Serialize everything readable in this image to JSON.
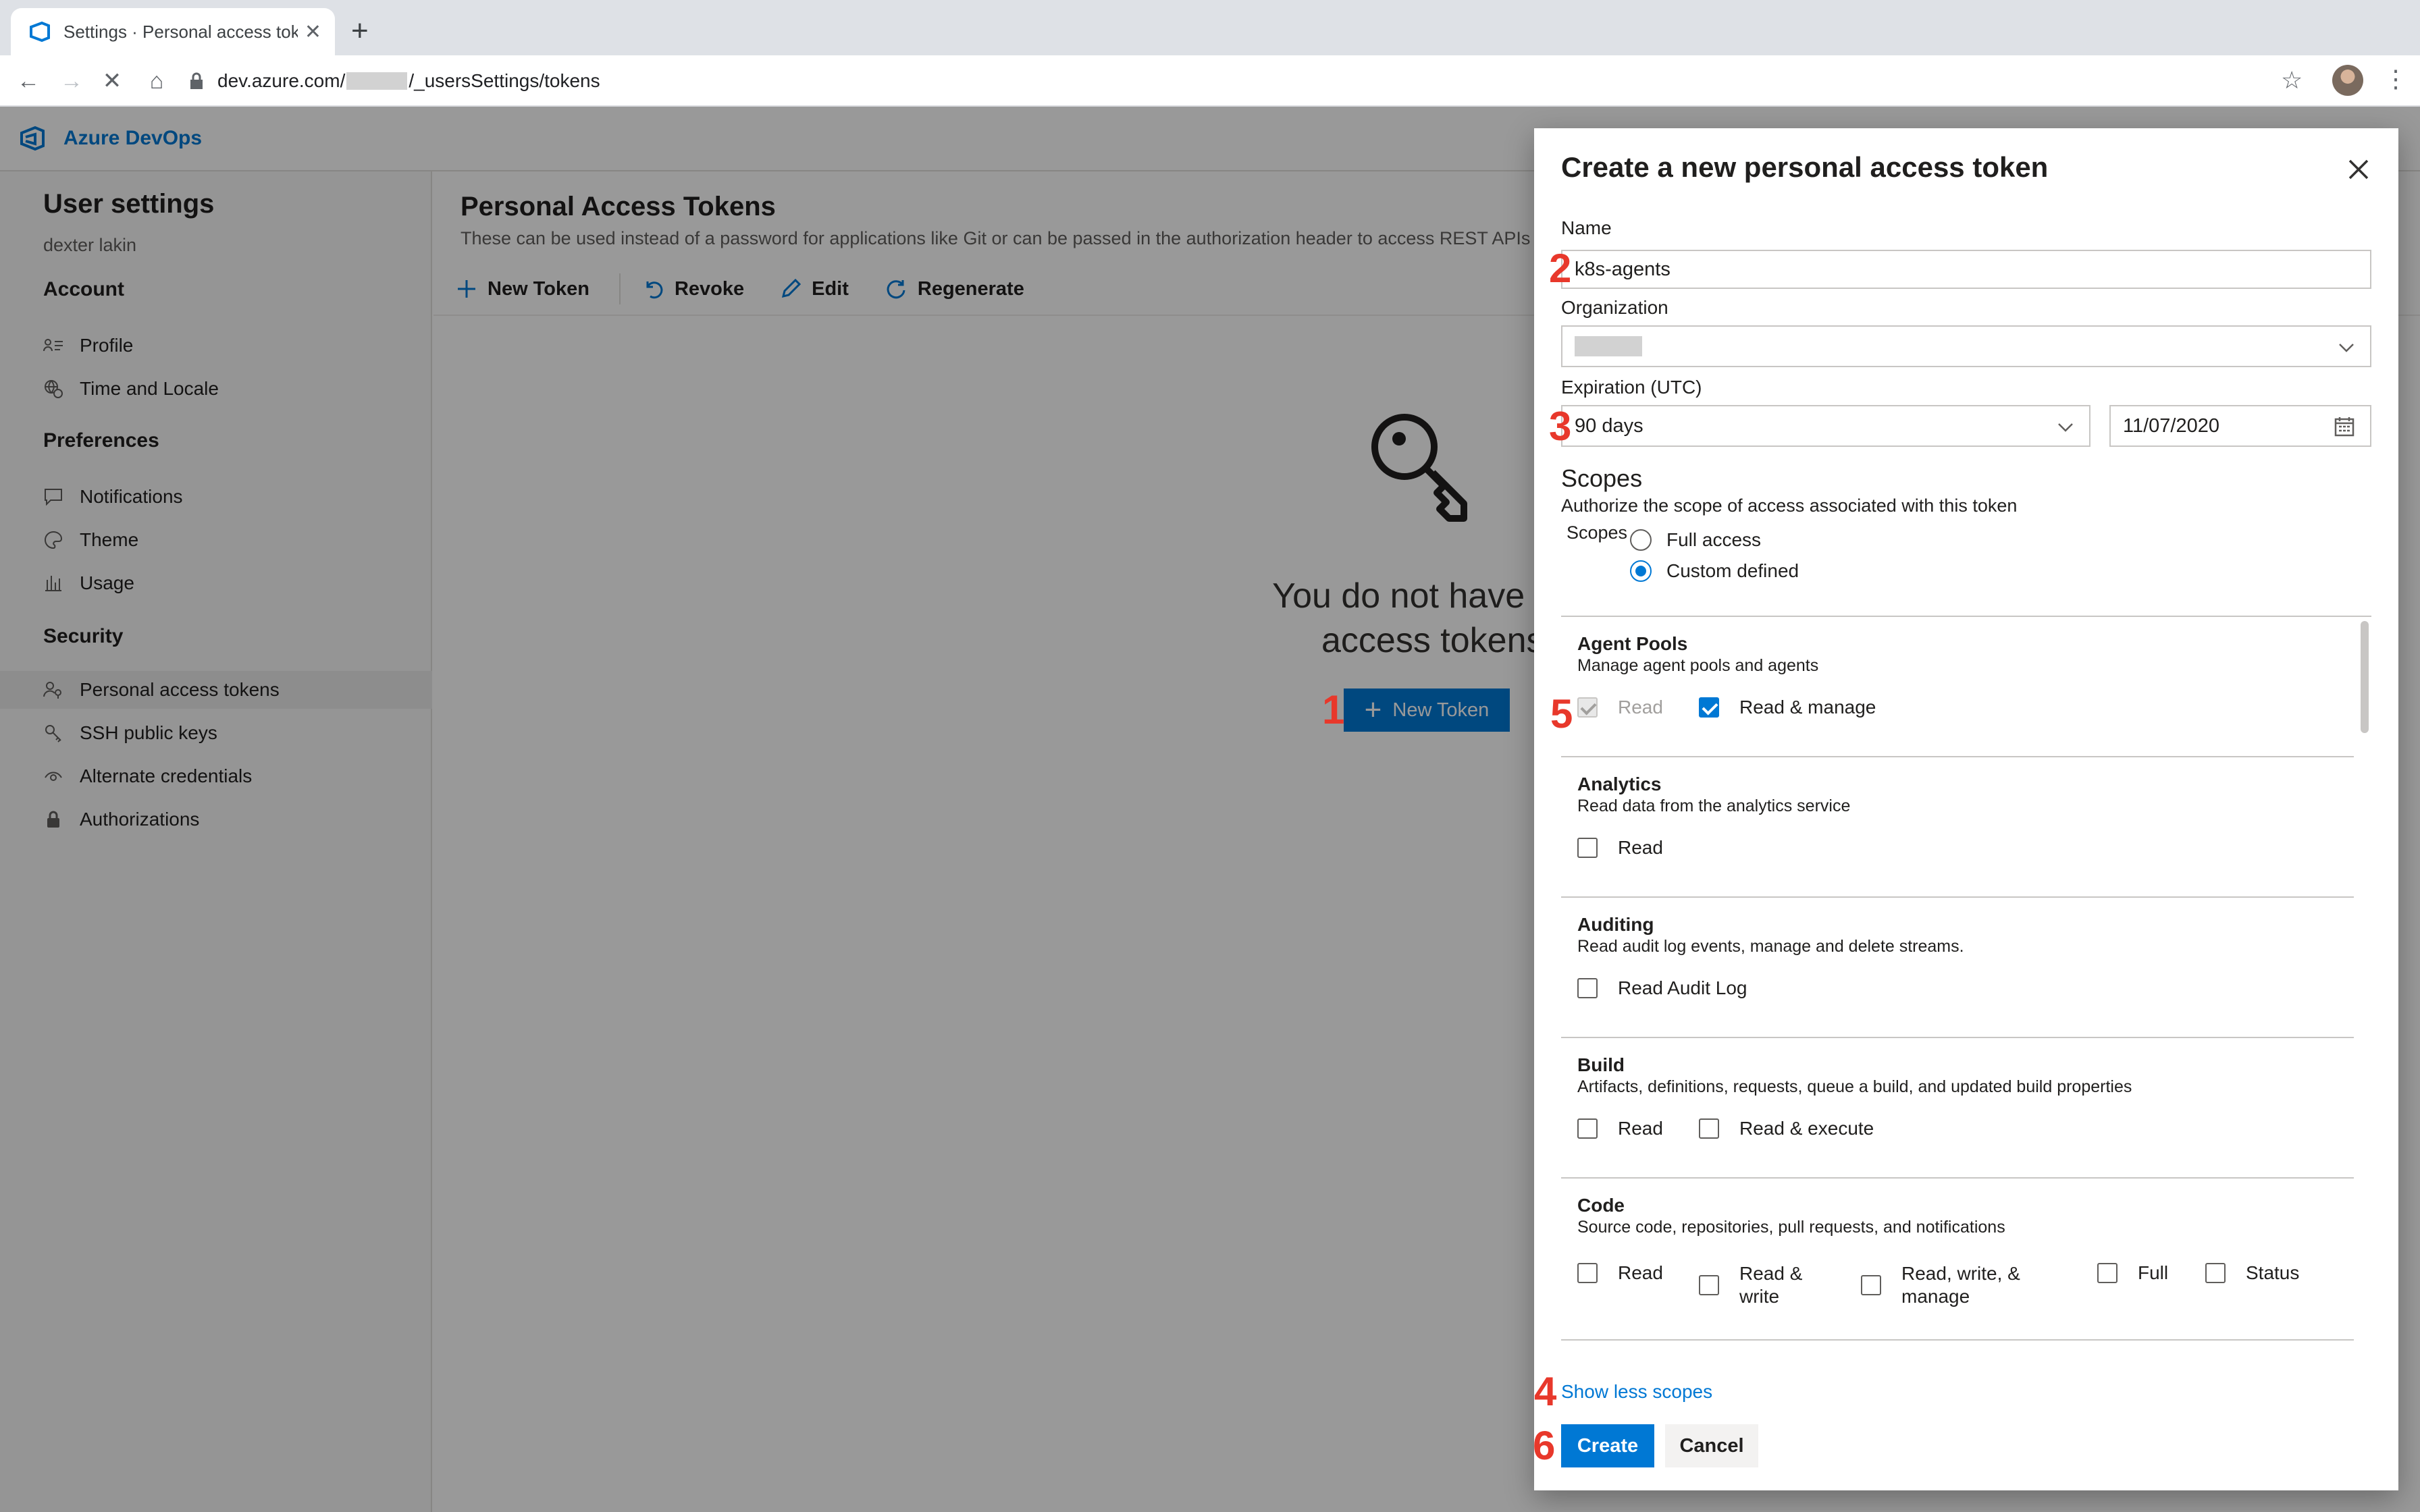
{
  "browser": {
    "tab_title": "Settings · Personal access tokens",
    "url_host": "dev.azure.com/",
    "url_path": "/_usersSettings/tokens"
  },
  "app": {
    "brand": "Azure DevOps",
    "colors": {
      "accent": "#0078d4",
      "annotation": "#e8382b"
    }
  },
  "sidebar": {
    "title": "User settings",
    "user": "dexter lakin",
    "sections": [
      {
        "title": "Account",
        "items": [
          {
            "label": "Profile",
            "icon": "profile-icon"
          },
          {
            "label": "Time and Locale",
            "icon": "globe-clock-icon"
          }
        ]
      },
      {
        "title": "Preferences",
        "items": [
          {
            "label": "Notifications",
            "icon": "chat-icon"
          },
          {
            "label": "Theme",
            "icon": "palette-icon"
          },
          {
            "label": "Usage",
            "icon": "chart-icon"
          }
        ]
      },
      {
        "title": "Security",
        "items": [
          {
            "label": "Personal access tokens",
            "icon": "people-key-icon",
            "active": true
          },
          {
            "label": "SSH public keys",
            "icon": "key-icon"
          },
          {
            "label": "Alternate credentials",
            "icon": "eye-icon"
          },
          {
            "label": "Authorizations",
            "icon": "lock-icon"
          }
        ]
      }
    ]
  },
  "main": {
    "title": "Personal Access Tokens",
    "description": "These can be used instead of a password for applications like Git or can be passed in the authorization header to access REST APIs",
    "toolbar": {
      "new_token": "New Token",
      "revoke": "Revoke",
      "edit": "Edit",
      "regenerate": "Regenerate"
    },
    "empty_line1": "You do not have any p",
    "empty_line2": "access tokens y",
    "new_token_button": "New Token"
  },
  "dialog": {
    "title": "Create a new personal access token",
    "name_label": "Name",
    "name_value": "k8s-agents",
    "organization_label": "Organization",
    "organization_value": "",
    "expiration_label": "Expiration (UTC)",
    "expiration_value": "90 days",
    "expiration_date": "11/07/2020",
    "scopes_heading": "Scopes",
    "scopes_description": "Authorize the scope of access associated with this token",
    "scopes_label": "Scopes",
    "scope_mode_full": "Full access",
    "scope_mode_custom": "Custom defined",
    "scope_mode_selected": "Custom defined",
    "scopes": [
      {
        "name": "Agent Pools",
        "description": "Manage agent pools and agents",
        "options": [
          {
            "label": "Read",
            "checked": true,
            "disabled": true
          },
          {
            "label": "Read & manage",
            "checked": true
          }
        ]
      },
      {
        "name": "Analytics",
        "description": "Read data from the analytics service",
        "options": [
          {
            "label": "Read",
            "checked": false
          }
        ]
      },
      {
        "name": "Auditing",
        "description": "Read audit log events, manage and delete streams.",
        "options": [
          {
            "label": "Read Audit Log",
            "checked": false
          }
        ]
      },
      {
        "name": "Build",
        "description": "Artifacts, definitions, requests, queue a build, and updated build properties",
        "options": [
          {
            "label": "Read",
            "checked": false
          },
          {
            "label": "Read & execute",
            "checked": false
          }
        ]
      },
      {
        "name": "Code",
        "description": "Source code, repositories, pull requests, and notifications",
        "options": [
          {
            "label": "Read",
            "checked": false
          },
          {
            "label": "Read & write",
            "checked": false
          },
          {
            "label": "Read, write, & manage",
            "checked": false
          },
          {
            "label": "Full",
            "checked": false
          },
          {
            "label": "Status",
            "checked": false
          }
        ]
      }
    ],
    "show_less": "Show less scopes",
    "create": "Create",
    "cancel": "Cancel"
  },
  "annotations": [
    "1",
    "2",
    "3",
    "4",
    "5",
    "6"
  ]
}
